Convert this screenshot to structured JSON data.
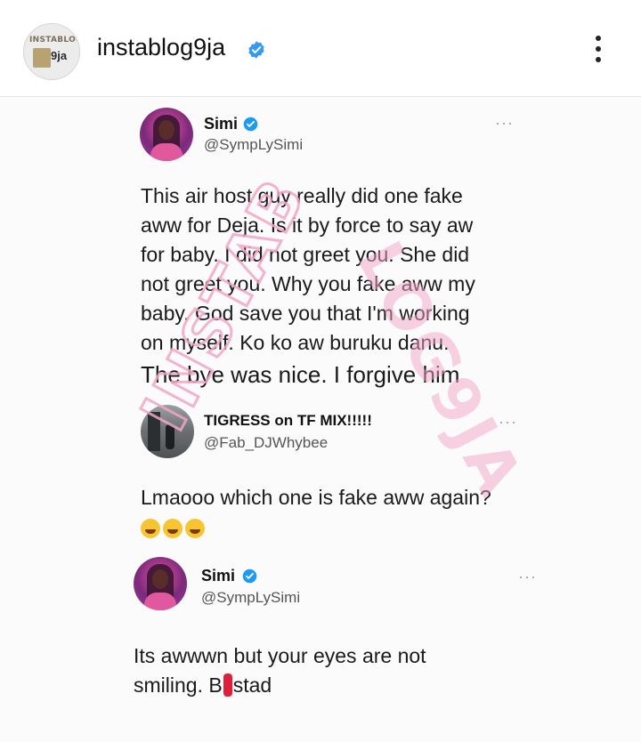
{
  "header": {
    "username": "instablog9ja",
    "avatar_text_top": "INSTABLOG",
    "avatar_text_num": "9ja"
  },
  "watermark": "INSTABLOG9JA",
  "tweets": [
    {
      "name": "Simi",
      "handle": "@SympLySimi",
      "verified": true,
      "lines": [
        "This air host guy really did one fake",
        "aww for Deja. Is it by force to say aw",
        "for baby. I did not greet you. She did",
        "not greet you. Why you fake aww my",
        "baby. God save you that I'm working",
        "on myself. Ko ko aw buruku danu."
      ],
      "last_line": "The bye was nice. I forgive him"
    },
    {
      "name": "TIGRESS on TF MIX!!!!!",
      "handle": "@Fab_DJWhybee",
      "verified": false,
      "lines": [
        "Lmaooo which one is fake aww again?"
      ]
    },
    {
      "name": "Simi",
      "handle": "@SympLySimi",
      "verified": true,
      "line1": "Its awwwn but your eyes are not",
      "line2_pre": "smiling. B",
      "line2_post": "stad"
    }
  ],
  "icons": {
    "verified": "verified-badge-icon",
    "more": "more-vertical-icon",
    "tweet_more": "more-horizontal-icon",
    "emoji": "laughing-face-emoji"
  },
  "colors": {
    "verified_blue": "#1d9bf0",
    "ig_verified_blue": "#3897f0",
    "watermark_pink": "#f2a6c6",
    "redact_red": "#e21f3a"
  }
}
